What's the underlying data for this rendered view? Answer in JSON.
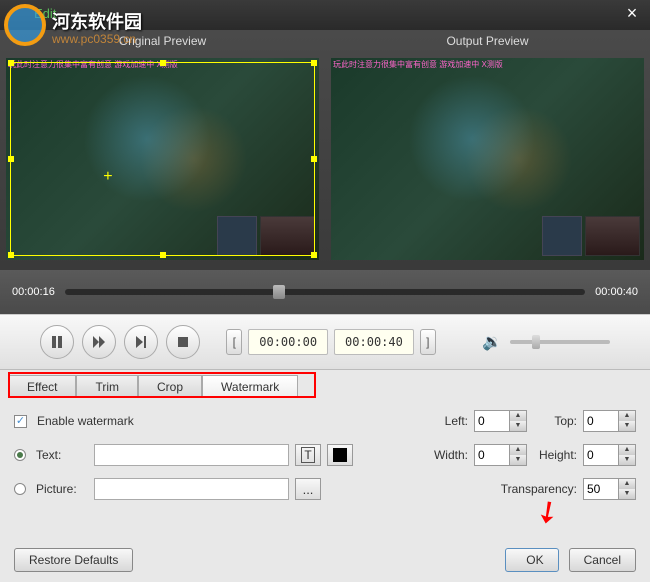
{
  "window": {
    "title": "Edit",
    "close": "×"
  },
  "watermark_logo": {
    "text": "河东软件园",
    "url": "www.pc0359.cn"
  },
  "preview": {
    "original": "Original Preview",
    "output": "Output Preview",
    "pink_overlay": "玩此时注意力很集中富有创意\n游戏加速中 X测版"
  },
  "seek": {
    "start": "00:00:16",
    "end": "00:00:40"
  },
  "controls": {
    "time_start": "00:00:00",
    "time_end": "00:00:40"
  },
  "tabs": {
    "effect": "Effect",
    "trim": "Trim",
    "crop": "Crop",
    "watermark": "Watermark"
  },
  "wm": {
    "enable": "Enable watermark",
    "text_label": "Text:",
    "picture_label": "Picture:",
    "browse": "...",
    "left_label": "Left:",
    "left_val": "0",
    "top_label": "Top:",
    "top_val": "0",
    "width_label": "Width:",
    "width_val": "0",
    "height_label": "Height:",
    "height_val": "0",
    "transparency_label": "Transparency:",
    "transparency_val": "50"
  },
  "buttons": {
    "restore": "Restore Defaults",
    "ok": "OK",
    "cancel": "Cancel"
  }
}
